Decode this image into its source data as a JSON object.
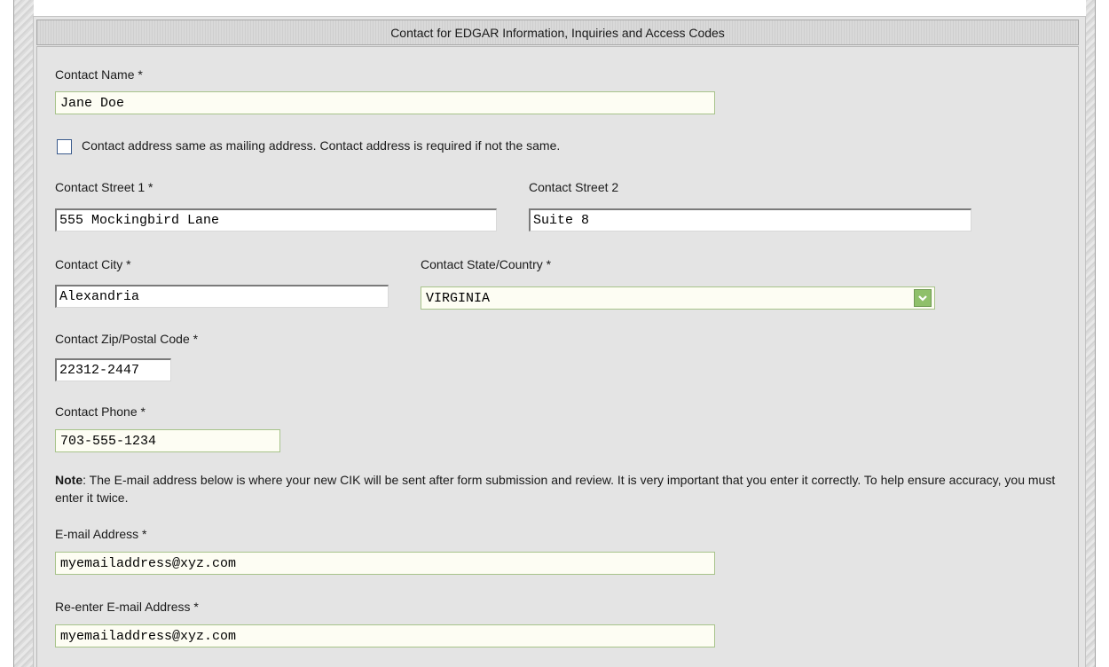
{
  "section": {
    "title": "Contact for EDGAR Information, Inquiries and Access Codes"
  },
  "contact_name": {
    "label": "Contact Name *",
    "value": "Jane Doe"
  },
  "same_address": {
    "checked": false,
    "label": "Contact address same as mailing address. Contact address is required if not the same."
  },
  "street1": {
    "label": "Contact Street 1 *",
    "value": "555 Mockingbird Lane"
  },
  "street2": {
    "label": "Contact Street 2",
    "value": "Suite 8"
  },
  "city": {
    "label": "Contact City *",
    "value": "Alexandria"
  },
  "state": {
    "label": "Contact State/Country *",
    "value": "VIRGINIA"
  },
  "zip": {
    "label": "Contact Zip/Postal Code *",
    "value": "22312-2447"
  },
  "phone": {
    "label": "Contact Phone *",
    "value": "703-555-1234"
  },
  "note": {
    "prefix": "Note",
    "text": ": The E-mail address below is where your new CIK will be sent after form submission and review. It is very important that you enter it correctly. To help ensure accuracy, you must enter it twice."
  },
  "email": {
    "label": "E-mail Address *",
    "value": "myemailaddress@xyz.com"
  },
  "email_confirm": {
    "label": "Re-enter E-mail Address *",
    "value": "myemailaddress@xyz.com"
  },
  "colors": {
    "field_border": "#a7c38a",
    "field_bg": "#fdfdf3",
    "panel_bg": "#e4e4e4",
    "select_button": "#8fc06a"
  }
}
